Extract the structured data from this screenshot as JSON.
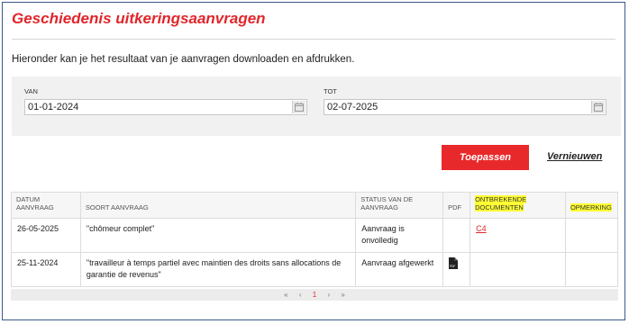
{
  "page": {
    "title": "Geschiedenis uitkeringsaanvragen",
    "intro": "Hieronder kan je het resultaat van je aanvragen downloaden en afdrukken."
  },
  "filter": {
    "from_label": "VAN",
    "from_value": "01-01-2024",
    "to_label": "TOT",
    "to_value": "02-07-2025",
    "apply_label": "Toepassen",
    "renew_label": "Vernieuwen"
  },
  "table": {
    "headers": {
      "date_line1": "DATUM",
      "date_line2": "AANVRAAG",
      "type": "SOORT AANVRAAG",
      "status_line1": "STATUS VAN DE",
      "status_line2": "AANVRAAG",
      "pdf": "PDF",
      "missing_line1": "ONTBREKENDE",
      "missing_line2": "DOCUMENTEN",
      "remark": "OPMERKING"
    },
    "rows": [
      {
        "date": "26-05-2025",
        "type": "\"chômeur complet\"",
        "status": "Aanvraag is onvolledig",
        "pdf": "",
        "missing": "C4",
        "remark": ""
      },
      {
        "date": "25-11-2024",
        "type": "\"travailleur à temps partiel avec maintien des droits sans allocations de garantie de revenus\"",
        "status": "Aanvraag afgewerkt",
        "pdf": "pdf-file-icon",
        "missing": "",
        "remark": ""
      }
    ]
  },
  "pager": {
    "first": "«",
    "prev": "‹",
    "current": "1",
    "next": "›",
    "last": "»"
  },
  "colors": {
    "accent": "#e0262b",
    "highlight": "#ffff33"
  }
}
